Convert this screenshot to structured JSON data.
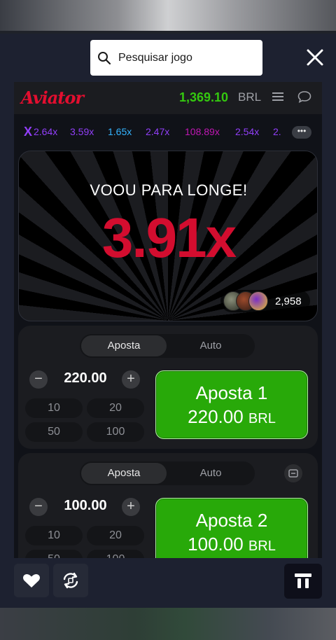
{
  "search": {
    "placeholder": "Pesquisar jogo"
  },
  "header": {
    "logo": "Aviator",
    "balance": "1,369.10",
    "currency": "BRL"
  },
  "history": {
    "x_label": "X",
    "multipliers": [
      {
        "value": "2.64x",
        "color": "#913ef8"
      },
      {
        "value": "3.59x",
        "color": "#913ef8"
      },
      {
        "value": "1.65x",
        "color": "#34b4ff"
      },
      {
        "value": "2.47x",
        "color": "#913ef8"
      },
      {
        "value": "108.89x",
        "color": "#c017b4"
      },
      {
        "value": "2.54x",
        "color": "#913ef8"
      },
      {
        "value": "2.",
        "color": "#913ef8"
      }
    ],
    "more_label": "•••"
  },
  "stage": {
    "message": "VOOU PARA LONGE!",
    "multiplier": "3.91x",
    "players_count": "2,958"
  },
  "bets": [
    {
      "tabs": [
        "Aposta",
        "Auto"
      ],
      "minus": "−",
      "plus": "+",
      "amount": "220.00",
      "quick": [
        "10",
        "20",
        "50",
        "100"
      ],
      "button_title": "Aposta 1",
      "button_amount": "220.00",
      "button_currency": "BRL"
    },
    {
      "tabs": [
        "Aposta",
        "Auto"
      ],
      "minus": "−",
      "plus": "+",
      "amount": "100.00",
      "quick": [
        "10",
        "20",
        "50",
        "100"
      ],
      "button_title": "Aposta 2",
      "button_amount": "100.00",
      "button_currency": "BRL"
    }
  ],
  "bottom": {
    "icons": [
      "heart-icon",
      "refresh-icon",
      "game-icon"
    ]
  },
  "colors": {
    "accent_red": "#d30d2f",
    "balance_green": "#34c80f",
    "bet_green": "#28a909"
  }
}
